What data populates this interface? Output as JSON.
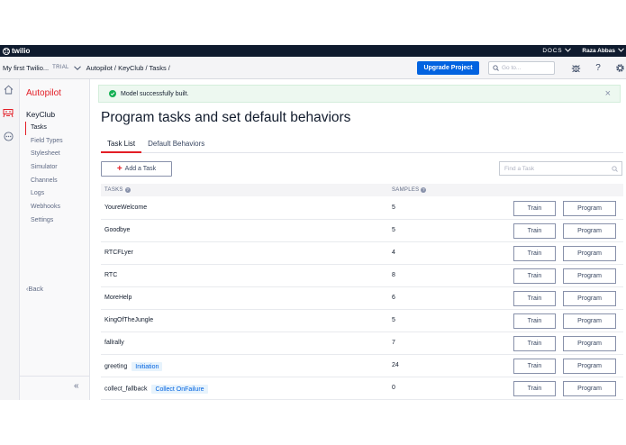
{
  "topbar": {
    "logo": "twilio",
    "docs": "DOCS",
    "user": "Raza Abbas"
  },
  "subbar": {
    "account": "My first Twilio...",
    "trial": "TRIAL",
    "breadcrumb": "Autopilot / KeyClub / Tasks /",
    "upgrade": "Upgrade Project",
    "goto_placeholder": "Go to...",
    "help": "?"
  },
  "sidebar": {
    "product": "Autopilot",
    "section": "KeyClub",
    "items": [
      {
        "label": "Tasks",
        "active": true
      },
      {
        "label": "Field Types",
        "active": false
      },
      {
        "label": "Stylesheet",
        "active": false
      },
      {
        "label": "Simulator",
        "active": false
      },
      {
        "label": "Channels",
        "active": false
      },
      {
        "label": "Logs",
        "active": false
      },
      {
        "label": "Webhooks",
        "active": false
      },
      {
        "label": "Settings",
        "active": false
      }
    ],
    "back": "Back",
    "collapse": "«"
  },
  "main": {
    "alert": "Model successfully built.",
    "title": "Program tasks and set default behaviors",
    "tabs": [
      {
        "label": "Task List",
        "active": true
      },
      {
        "label": "Default Behaviors",
        "active": false
      }
    ],
    "add_task": "Add a Task",
    "find_placeholder": "Find a Task",
    "columns": {
      "tasks": "TASKS",
      "samples": "SAMPLES"
    },
    "train_label": "Train",
    "program_label": "Program",
    "rows": [
      {
        "name": "YoureWelcome",
        "badge": "",
        "samples": "5"
      },
      {
        "name": "Goodbye",
        "badge": "",
        "samples": "5"
      },
      {
        "name": "RTCFLyer",
        "badge": "",
        "samples": "4"
      },
      {
        "name": "RTC",
        "badge": "",
        "samples": "8"
      },
      {
        "name": "MoreHelp",
        "badge": "",
        "samples": "6"
      },
      {
        "name": "KingOfTheJungle",
        "badge": "",
        "samples": "5"
      },
      {
        "name": "fallrally",
        "badge": "",
        "samples": "7"
      },
      {
        "name": "greeting",
        "badge": "Initiation",
        "samples": "24"
      },
      {
        "name": "collect_fallback",
        "badge": "Collect OnFailure",
        "samples": "0"
      }
    ]
  },
  "colors": {
    "topbar": "#0f1b2e",
    "accent_red": "#e31e26",
    "primary_blue": "#0263e0",
    "success_green": "#14b053"
  }
}
